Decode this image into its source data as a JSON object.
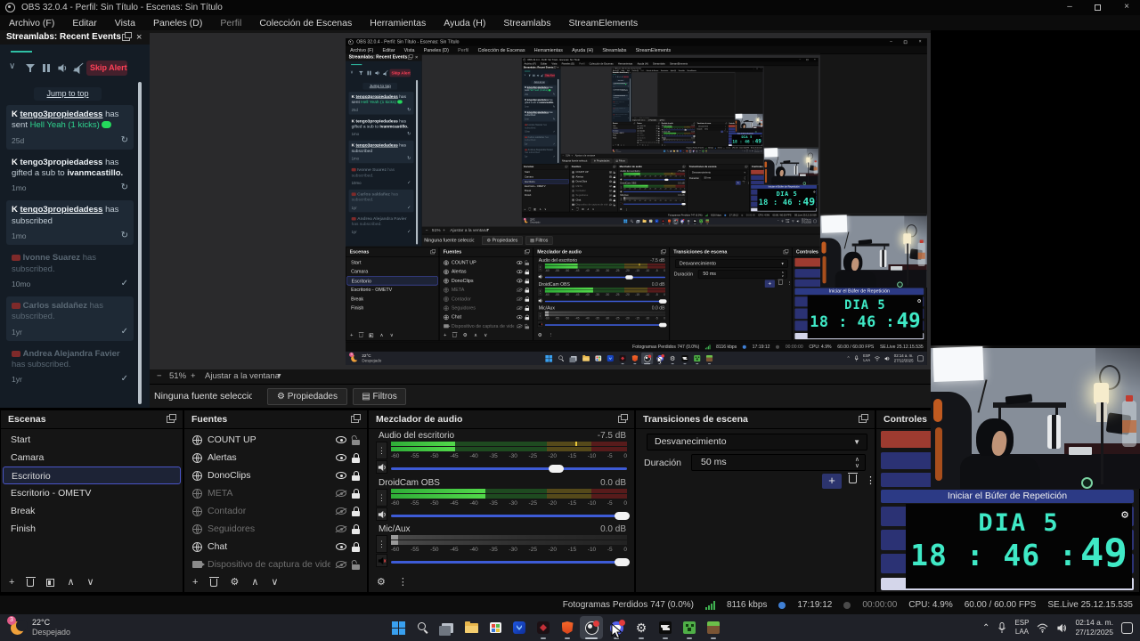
{
  "window": {
    "title": "OBS 32.0.4 - Perfil: Sin Título - Escenas: Sin Título"
  },
  "menu": {
    "items": [
      "Archivo (F)",
      "Editar",
      "Vista",
      "Paneles (D)",
      "Perfil",
      "Colección de Escenas",
      "Herramientas",
      "Ayuda (H)",
      "Streamlabs",
      "StreamElements"
    ]
  },
  "streamlabs": {
    "title": "Streamlabs: Recent Events",
    "skip_alert": "Skip Alert",
    "jump_to_top": "Jump to top",
    "events": [
      {
        "platform": "kick",
        "user": "tengo3propiedadess",
        "action": "has sent",
        "highlight": "Hell Yeah (1 kicks)",
        "time": "25d",
        "status": "refresh"
      },
      {
        "platform": "kick",
        "user": "tengo3propiedadess",
        "action": "has gifted a sub to",
        "target": "ivanmcastillo.",
        "time": "1mo",
        "status": "refresh"
      },
      {
        "platform": "kick",
        "user": "tengo3propiedadess",
        "action": "has subscribed",
        "time": "1mo",
        "status": "refresh"
      },
      {
        "platform": "youtube",
        "user": "Ivonne Suarez",
        "action": "has subscribed.",
        "time": "10mo",
        "status": "check"
      },
      {
        "platform": "youtube",
        "user": "Carlos saldañez",
        "action": "has subscribed.",
        "time": "1yr",
        "status": "check"
      },
      {
        "platform": "youtube",
        "user": "Andrea Alejandra Favier",
        "action": "has subscribed.",
        "time": "1yr",
        "status": "check"
      }
    ]
  },
  "preview": {
    "zoom_out": "−",
    "zoom_level": "51%",
    "zoom_in": "+",
    "fit_label": "Ajustar a la ventana",
    "no_source": "Ninguna fuente seleccionada",
    "properties_label": "Propiedades",
    "filters_label": "Filtros"
  },
  "scenes": {
    "title": "Escenas",
    "selected": "Escritorio",
    "items": [
      "Start",
      "Camara",
      "Escritorio",
      "Escritorio - OMETV",
      "Break",
      "Finish"
    ]
  },
  "sources": {
    "title": "Fuentes",
    "items": [
      {
        "label": "COUNT UP",
        "icon": "globe",
        "visible": true,
        "locked": false
      },
      {
        "label": "Alertas",
        "icon": "globe",
        "visible": true,
        "locked": true
      },
      {
        "label": "DonoClips",
        "icon": "globe",
        "visible": true,
        "locked": true
      },
      {
        "label": "META",
        "icon": "globe",
        "visible": false,
        "locked": true
      },
      {
        "label": "Contador",
        "icon": "globe",
        "visible": false,
        "locked": true
      },
      {
        "label": "Seguidores",
        "icon": "globe",
        "visible": false,
        "locked": true
      },
      {
        "label": "Chat",
        "icon": "globe",
        "visible": true,
        "locked": true
      },
      {
        "label": "Dispositivo de captura de video",
        "icon": "camera",
        "visible": false,
        "locked": false
      }
    ]
  },
  "mixer": {
    "title": "Mezclador de audio",
    "ticks": [
      "-60",
      "-55",
      "-50",
      "-45",
      "-40",
      "-35",
      "-30",
      "-25",
      "-20",
      "-15",
      "-10",
      "-5",
      "0"
    ],
    "channels": [
      {
        "name": "Audio del escritorio",
        "db": "-7.5 dB",
        "muted": false,
        "level_pct": 27,
        "peak_pct": 78,
        "slider_pct": 70
      },
      {
        "name": "DroidCam OBS",
        "db": "0.0 dB",
        "muted": false,
        "level_pct": 40,
        "slider_pct": 98
      },
      {
        "name": "Mic/Aux",
        "db": "0.0 dB",
        "muted": true,
        "level_pct": 3,
        "slider_pct": 98
      }
    ]
  },
  "transitions": {
    "title": "Transiciones de escena",
    "selected": "Desvanecimiento",
    "duration_label": "Duración",
    "duration_value": "50 ms"
  },
  "controls": {
    "title": "Controles",
    "replay_buffer_label": "Iniciar el Búfer de Repetición"
  },
  "status": {
    "frames": "Fotogramas Perdidos 747 (0.0%)",
    "bitrate": "8116 kbps",
    "live_time": "17:19:12",
    "rec_time": "00:00:00",
    "cpu": "CPU: 4.9%",
    "fps": "60.00 / 60.00 FPS",
    "version": "SE.Live 25.12.15.535"
  },
  "overlay_timer": {
    "day": "DIA 5",
    "hm": "18 : 46 :",
    "seconds": "49"
  },
  "taskbar": {
    "weather_temp": "22°C",
    "weather_desc": "Despejado",
    "weather_badge": "3",
    "lang_top": "ESP",
    "lang_bottom": "LAA",
    "time": "02:14 a. m.",
    "date": "27/12/2025"
  }
}
